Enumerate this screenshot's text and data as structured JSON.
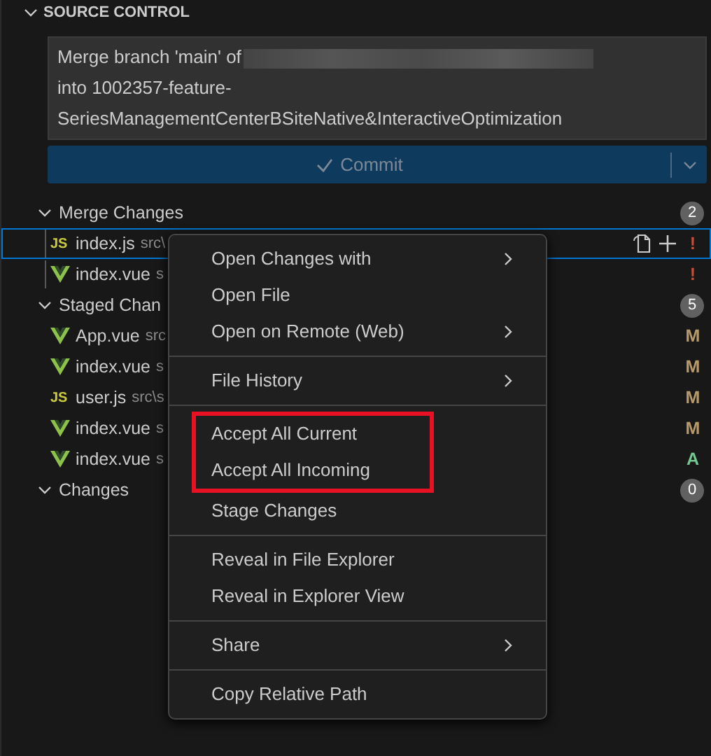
{
  "section": {
    "title": "SOURCE CONTROL",
    "expanded": true
  },
  "message": {
    "first_line": "Merge branch 'main' of",
    "lines": [
      "into 1002357-feature-",
      "SeriesManagementCenterBSiteNative&InteractiveOptimization"
    ]
  },
  "commit_button": {
    "label": "Commit",
    "disabled": true
  },
  "groups": [
    {
      "title": "Merge Changes",
      "count": "2",
      "expanded": true,
      "files": [
        {
          "kind": "js",
          "badge": "JS",
          "name": "index.js",
          "path": "src\\",
          "status": "!",
          "color": "#c74e39",
          "selected": true
        },
        {
          "kind": "vue",
          "name": "index.vue",
          "path": "s",
          "status": "!",
          "color": "#c74e39",
          "selected": false
        }
      ]
    },
    {
      "title": "Staged Chan",
      "count": "5",
      "expanded": true,
      "files": [
        {
          "kind": "vue",
          "name": "App.vue",
          "path": "src",
          "status": "M",
          "color": "#b89a6a",
          "selected": false
        },
        {
          "kind": "vue",
          "name": "index.vue",
          "path": "s",
          "status": "M",
          "color": "#b89a6a",
          "selected": false
        },
        {
          "kind": "js",
          "badge": "JS",
          "name": "user.js",
          "path": "src\\s",
          "status": "M",
          "color": "#b89a6a",
          "selected": false
        },
        {
          "kind": "vue",
          "name": "index.vue",
          "path": "s",
          "status": "M",
          "color": "#b89a6a",
          "selected": false
        },
        {
          "kind": "vue",
          "name": "index.vue",
          "path": "s",
          "status": "A",
          "color": "#73c991",
          "selected": false
        }
      ]
    },
    {
      "title": "Changes",
      "count": "0",
      "expanded": true
    }
  ],
  "context_menu": [
    [
      {
        "label": "Open Changes with",
        "submenu": true
      },
      {
        "label": "Open File",
        "submenu": false
      },
      {
        "label": "Open on Remote (Web)",
        "submenu": true
      }
    ],
    [
      {
        "label": "File History",
        "submenu": true
      }
    ],
    [
      {
        "label": "Accept All Current",
        "submenu": false,
        "highlighted": true
      },
      {
        "label": "Accept All Incoming",
        "submenu": false,
        "highlighted": true
      },
      {
        "label": "Stage Changes",
        "submenu": false,
        "highlighted": false
      }
    ],
    [
      {
        "label": "Reveal in File Explorer",
        "submenu": false
      },
      {
        "label": "Reveal in Explorer View",
        "submenu": false
      }
    ],
    [
      {
        "label": "Share",
        "submenu": true
      }
    ],
    [
      {
        "label": "Copy Relative Path",
        "submenu": false
      }
    ]
  ]
}
